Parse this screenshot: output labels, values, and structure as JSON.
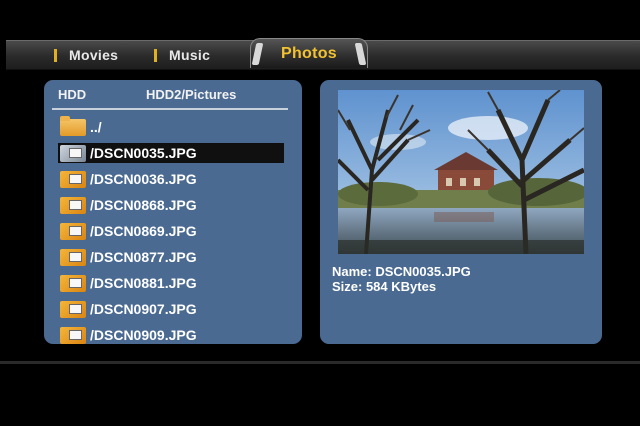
{
  "tabs": {
    "movies": "Movies",
    "music": "Music",
    "photos": "Photos",
    "active": "photos"
  },
  "browser": {
    "device": "HDD",
    "path": "HDD2/Pictures",
    "items": [
      {
        "name": "../",
        "type": "folder",
        "selected": false
      },
      {
        "name": "/DSCN0035.JPG",
        "type": "photo",
        "selected": true
      },
      {
        "name": "/DSCN0036.JPG",
        "type": "photo",
        "selected": false
      },
      {
        "name": "/DSCN0868.JPG",
        "type": "photo",
        "selected": false
      },
      {
        "name": "/DSCN0869.JPG",
        "type": "photo",
        "selected": false
      },
      {
        "name": "/DSCN0877.JPG",
        "type": "photo",
        "selected": false
      },
      {
        "name": "/DSCN0881.JPG",
        "type": "photo",
        "selected": false
      },
      {
        "name": "/DSCN0907.JPG",
        "type": "photo",
        "selected": false
      },
      {
        "name": "/DSCN0909.JPG",
        "type": "photo",
        "selected": false
      }
    ]
  },
  "preview": {
    "name_line": "Name: DSCN0035.JPG",
    "size_line": "Size: 584 KBytes"
  },
  "icons": {
    "folder": "folder-up-icon",
    "photo": "photo-file-icon"
  },
  "colors": {
    "panel": "#4a6a92",
    "active_tab_text": "#f2c230",
    "tab_marker": "#e0b020",
    "background": "#000000"
  }
}
